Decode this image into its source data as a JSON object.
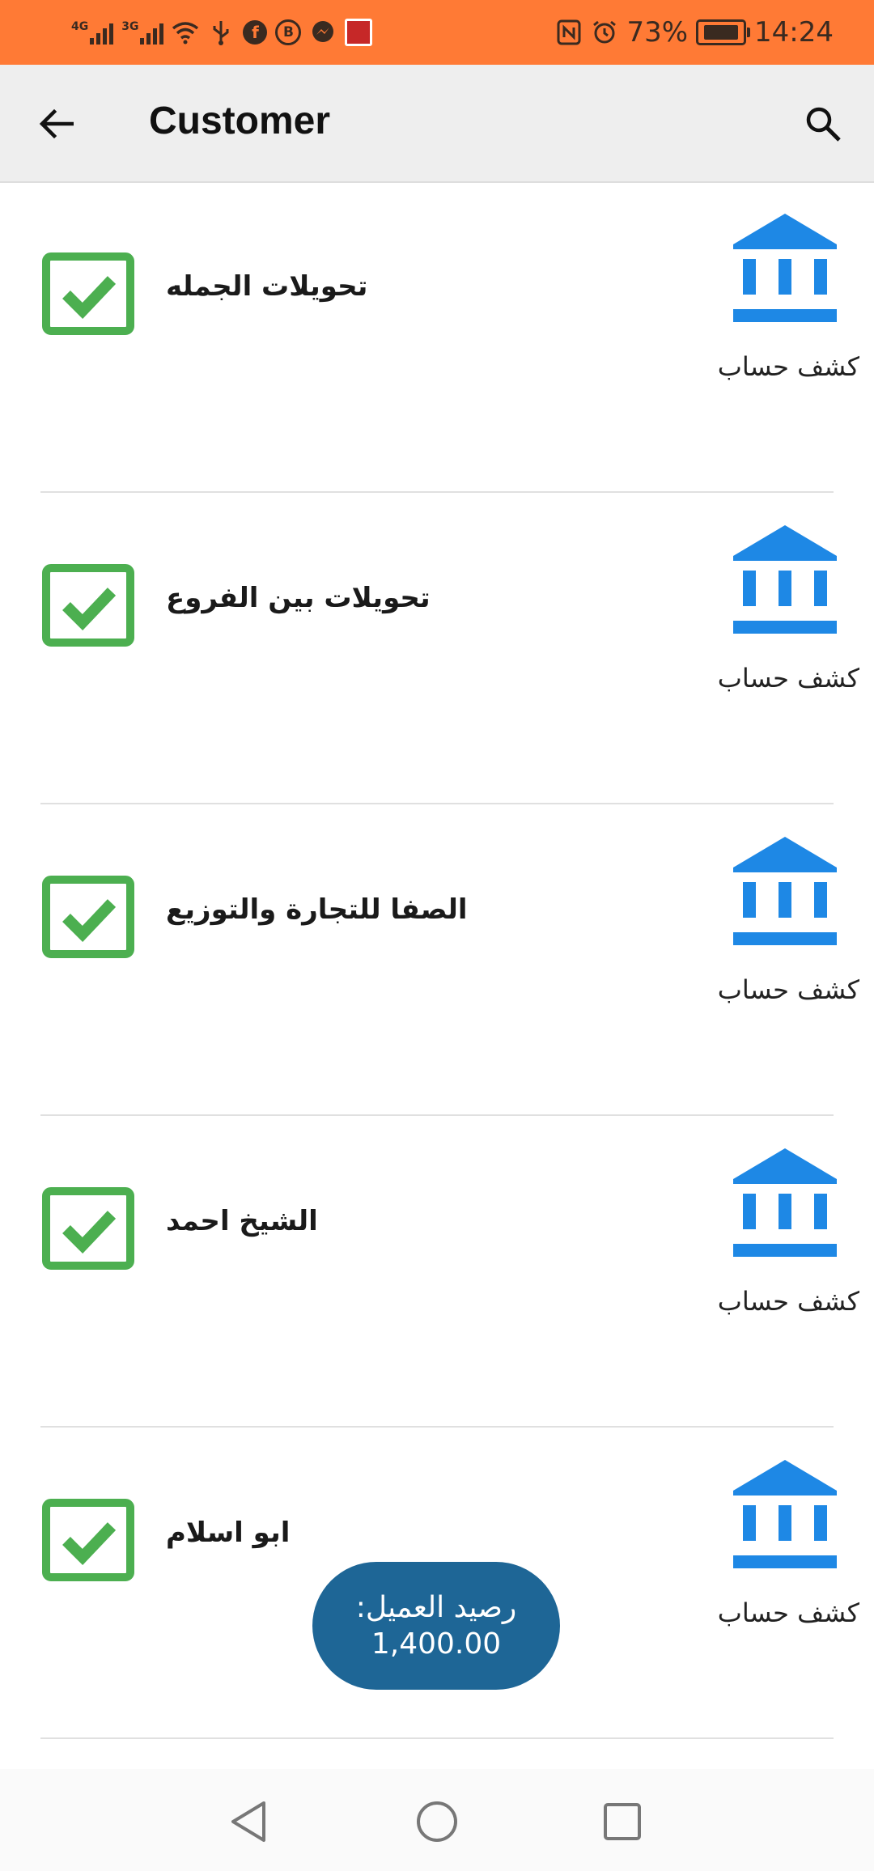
{
  "status_bar": {
    "net1": "4G",
    "net2": "3G",
    "battery_text": "73%",
    "time": "14:24",
    "bg_color": "#FF7A35"
  },
  "app_bar": {
    "title": "Customer",
    "back_icon": "arrow-left-icon",
    "search_icon": "search-icon"
  },
  "customers": [
    {
      "name": "تحويلات الجمله",
      "statement_label": "كشف حساب"
    },
    {
      "name": "تحويلات بين الفروع",
      "statement_label": "كشف حساب"
    },
    {
      "name": "الصفا للتجارة والتوزيع",
      "statement_label": "كشف حساب"
    },
    {
      "name": "الشيخ احمد",
      "statement_label": "كشف حساب"
    },
    {
      "name": "ابو اسلام",
      "statement_label": "كشف حساب"
    }
  ],
  "balance": {
    "label": "رصيد العميل:",
    "value": "1,400.00",
    "bg_color": "#1E6696"
  },
  "colors": {
    "check_green": "#4CAF50",
    "bank_blue": "#1E88E5"
  }
}
